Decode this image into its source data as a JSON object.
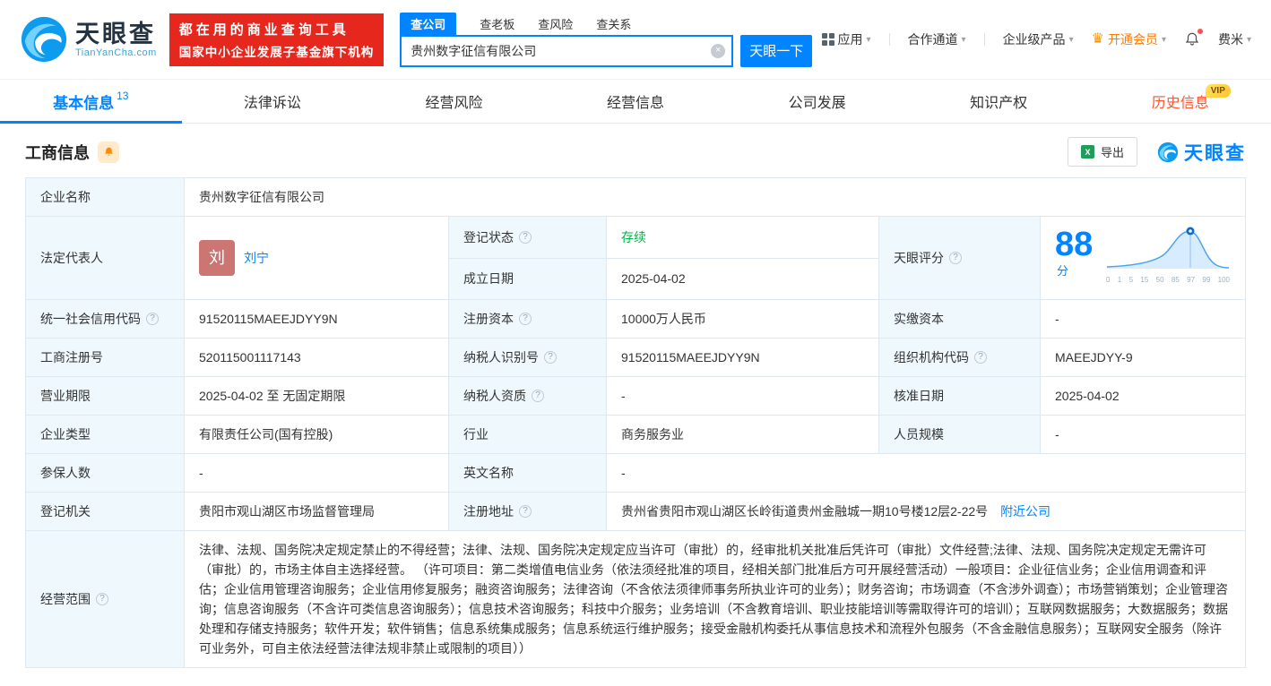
{
  "icons": {
    "caret": "▾",
    "crown": "♛",
    "help": "?",
    "clear": "×",
    "excel": "X"
  },
  "header": {
    "logo": {
      "title": "天眼查",
      "subtitle": "TianYanCha.com"
    },
    "banner": {
      "line1": "都在用的商业查询工具",
      "line2": "国家中小企业发展子基金旗下机构"
    },
    "search": {
      "tabs": [
        {
          "label": "查公司"
        },
        {
          "label": "查老板"
        },
        {
          "label": "查风险"
        },
        {
          "label": "查关系"
        }
      ],
      "value": "贵州数字征信有限公司",
      "button": "天眼一下"
    },
    "nav": {
      "apps": "应用",
      "partner": "合作通道",
      "enterprise": "企业级产品",
      "vip": "开通会员",
      "user": "费米"
    }
  },
  "tabs": {
    "items": [
      {
        "label": "基本信息",
        "count": "13"
      },
      {
        "label": "法律诉讼"
      },
      {
        "label": "经营风险"
      },
      {
        "label": "经营信息"
      },
      {
        "label": "公司发展"
      },
      {
        "label": "知识产权"
      },
      {
        "label": "历史信息",
        "badge": "VIP"
      }
    ]
  },
  "section": {
    "title": "工商信息",
    "export": "导出",
    "brand": "天眼查"
  },
  "info": {
    "company_name": {
      "label": "企业名称",
      "value": "贵州数字征信有限公司"
    },
    "legal_rep": {
      "label": "法定代表人",
      "avatar": "刘",
      "value": "刘宁"
    },
    "reg_status": {
      "label": "登记状态",
      "value": "存续"
    },
    "establish_date": {
      "label": "成立日期",
      "value": "2025-04-02"
    },
    "score": {
      "label": "天眼评分",
      "value": "88",
      "unit": "分",
      "ticks": [
        "0",
        "1",
        "5",
        "15",
        "50",
        "85",
        "97",
        "99",
        "100"
      ]
    },
    "credit_code": {
      "label": "统一社会信用代码",
      "value": "91520115MAEEJDYY9N"
    },
    "reg_capital": {
      "label": "注册资本",
      "value": "10000万人民币"
    },
    "paid_capital": {
      "label": "实缴资本",
      "value": "-"
    },
    "reg_number": {
      "label": "工商注册号",
      "value": "520115001117143"
    },
    "taxpayer_id": {
      "label": "纳税人识别号",
      "value": "91520115MAEEJDYY9N"
    },
    "org_code": {
      "label": "组织机构代码",
      "value": "MAEEJDYY-9"
    },
    "business_term": {
      "label": "营业期限",
      "value": "2025-04-02 至 无固定期限"
    },
    "taxpayer_quality": {
      "label": "纳税人资质",
      "value": "-"
    },
    "approval_date": {
      "label": "核准日期",
      "value": "2025-04-02"
    },
    "company_type": {
      "label": "企业类型",
      "value": "有限责任公司(国有控股)"
    },
    "industry": {
      "label": "行业",
      "value": "商务服务业"
    },
    "staff_size": {
      "label": "人员规模",
      "value": "-"
    },
    "insured_count": {
      "label": "参保人数",
      "value": "-"
    },
    "english_name": {
      "label": "英文名称",
      "value": "-"
    },
    "reg_authority": {
      "label": "登记机关",
      "value": "贵阳市观山湖区市场监督管理局"
    },
    "reg_address": {
      "label": "注册地址",
      "value": "贵州省贵阳市观山湖区长岭街道贵州金融城一期10号楼12层2-22号",
      "link": "附近公司"
    },
    "business_scope": {
      "label": "经营范围",
      "value": "法律、法规、国务院决定规定禁止的不得经营；法律、法规、国务院决定规定应当许可（审批）的，经审批机关批准后凭许可（审批）文件经营;法律、法规、国务院决定规定无需许可（审批）的，市场主体自主选择经营。 （许可项目：第二类增值电信业务（依法须经批准的项目，经相关部门批准后方可开展经营活动）一般项目：企业征信业务；企业信用调查和评估；企业信用管理咨询服务；企业信用修复服务；融资咨询服务；法律咨询（不含依法须律师事务所执业许可的业务）；财务咨询；市场调查（不含涉外调查）；市场营销策划；企业管理咨询；信息咨询服务（不含许可类信息咨询服务）；信息技术咨询服务；科技中介服务；业务培训（不含教育培训、职业技能培训等需取得许可的培训）；互联网数据服务；大数据服务；数据处理和存储支持服务；软件开发；软件销售；信息系统集成服务；信息系统运行维护服务；接受金融机构委托从事信息技术和流程外包服务（不含金融信息服务）；互联网安全服务（除许可业务外，可自主依法经营法律法规非禁止或限制的项目））"
    }
  },
  "colors": {
    "primary": "#0084ff",
    "status_green": "#00b34a",
    "banner_red": "#e6271e",
    "vip_orange": "#ff7a00"
  }
}
